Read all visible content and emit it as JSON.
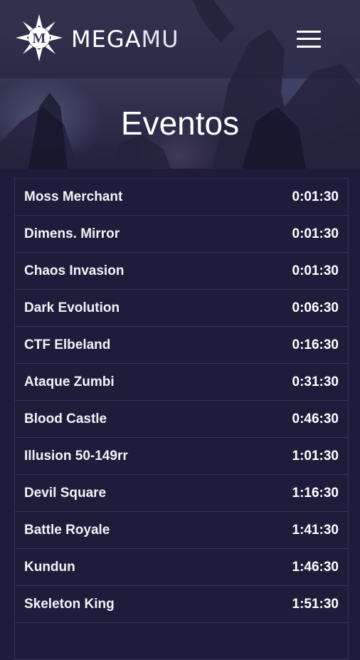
{
  "brand": {
    "name_part1": "MEGA",
    "name_part2": "MU",
    "logo_letter": "M"
  },
  "header": {
    "menu_icon": "hamburger-icon"
  },
  "page": {
    "title": "Eventos"
  },
  "events": [
    {
      "name": "Moss Merchant",
      "time": "0:01:30"
    },
    {
      "name": "Dimens. Mirror",
      "time": "0:01:30"
    },
    {
      "name": "Chaos Invasion",
      "time": "0:01:30"
    },
    {
      "name": "Dark Evolution",
      "time": "0:06:30"
    },
    {
      "name": "CTF Elbeland",
      "time": "0:16:30"
    },
    {
      "name": "Ataque Zumbi",
      "time": "0:31:30"
    },
    {
      "name": "Blood Castle",
      "time": "0:46:30"
    },
    {
      "name": "Illusion 50-149rr",
      "time": "1:01:30"
    },
    {
      "name": "Devil Square",
      "time": "1:16:30"
    },
    {
      "name": "Battle Royale",
      "time": "1:41:30"
    },
    {
      "name": "Kundun",
      "time": "1:46:30"
    },
    {
      "name": "Skeleton King",
      "time": "1:51:30"
    },
    {
      "name": "",
      "time": ""
    }
  ],
  "colors": {
    "background": "#1f1c3b",
    "row_border": "#35325c",
    "text": "#ffffff"
  }
}
